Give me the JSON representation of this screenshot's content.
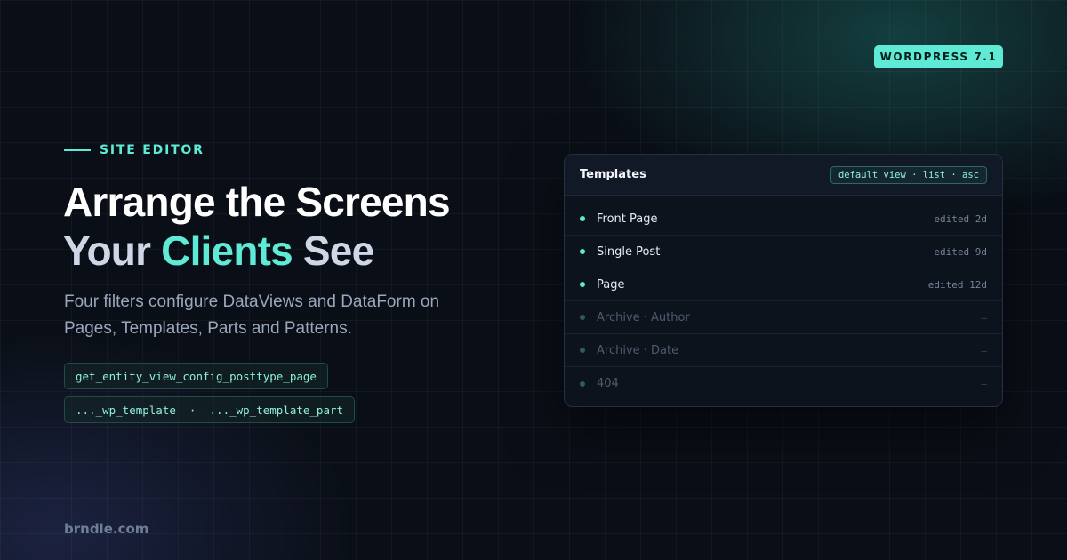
{
  "badge": "WORDPRESS 7.1",
  "eyebrow": "SITE EDITOR",
  "headline": {
    "line1": "Arrange the Screens",
    "line2_prefix": "Your ",
    "line2_accent": "Clients",
    "line2_suffix": " See"
  },
  "subtitle": "Four filters configure DataViews and DataForm on Pages, Templates, Parts and Patterns.",
  "code_chips": [
    "get_entity_view_config_posttype_page",
    "..._wp_template  ·  ..._wp_template_part"
  ],
  "panel": {
    "title": "Templates",
    "tag": "default_view · list · asc",
    "rows": [
      {
        "name": "Front Page",
        "meta": "edited 2d"
      },
      {
        "name": "Single Post",
        "meta": "edited 9d"
      },
      {
        "name": "Page",
        "meta": "edited 12d"
      },
      {
        "name": "Archive · Author",
        "meta": "–"
      },
      {
        "name": "Archive · Date",
        "meta": "–"
      },
      {
        "name": "404",
        "meta": "–"
      }
    ]
  },
  "footer": "brndle.com",
  "colors": {
    "accent": "#5eead4",
    "background": "#0a0f17"
  }
}
